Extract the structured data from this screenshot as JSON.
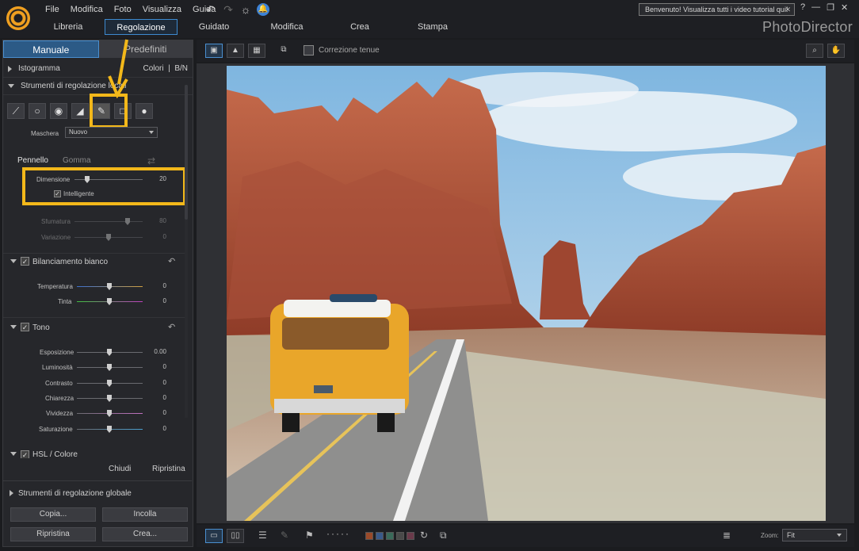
{
  "app": {
    "brand": "PhotoDirector"
  },
  "menu": [
    "File",
    "Modifica",
    "Foto",
    "Visualizza",
    "Guida"
  ],
  "welcome": {
    "text": "Benvenuto! Visualizza tutti i video tutorial qui!",
    "close": "✕"
  },
  "window_controls": [
    "?",
    "—",
    "❐",
    "✕"
  ],
  "mode_tabs": [
    "Libreria",
    "Regolazione",
    "Guidato",
    "Modifica",
    "Crea",
    "Stampa"
  ],
  "active_mode": "Regolazione",
  "panel_tabs": {
    "manual": "Manuale",
    "presets": "Predefiniti"
  },
  "histogram": {
    "label": "Istogramma",
    "colors": "Colori",
    "bw": "B/N"
  },
  "local_tools": {
    "label": "Strumenti di regolazione locali"
  },
  "mask": {
    "label": "Maschera",
    "value": "Nuovo"
  },
  "brush": {
    "pennello": "Pennello",
    "gomma": "Gomma"
  },
  "sliders_brush": [
    {
      "label": "Dimensione",
      "value": "20"
    },
    {
      "label": "Sfumatura",
      "value": "80"
    },
    {
      "label": "Variazione",
      "value": "0"
    }
  ],
  "intelligente": "Intelligente",
  "white_balance": {
    "title": "Bilanciamento bianco",
    "sliders": [
      {
        "label": "Temperatura",
        "value": "0"
      },
      {
        "label": "Tinta",
        "value": "0"
      }
    ]
  },
  "tone": {
    "title": "Tono",
    "sliders": [
      {
        "label": "Esposizione",
        "value": "0.00"
      },
      {
        "label": "Luminosità",
        "value": "0"
      },
      {
        "label": "Contrasto",
        "value": "0"
      },
      {
        "label": "Chiarezza",
        "value": "0"
      },
      {
        "label": "Vividezza",
        "value": "0"
      },
      {
        "label": "Saturazione",
        "value": "0"
      }
    ]
  },
  "hsl": {
    "title": "HSL / Colore"
  },
  "actions": {
    "close": "Chiudi",
    "reset": "Ripristina"
  },
  "global_tools": {
    "label": "Strumenti di regolazione globale"
  },
  "buttons": {
    "copy": "Copia...",
    "paste": "Incolla",
    "reset": "Ripristina",
    "create": "Crea..."
  },
  "toolbar": {
    "correzione": "Correzione tenue"
  },
  "zoom": {
    "label": "Zoom:",
    "value": "Fit"
  },
  "colors": {
    "accent": "#3d8ad0",
    "highlight": "#f3b81a"
  }
}
